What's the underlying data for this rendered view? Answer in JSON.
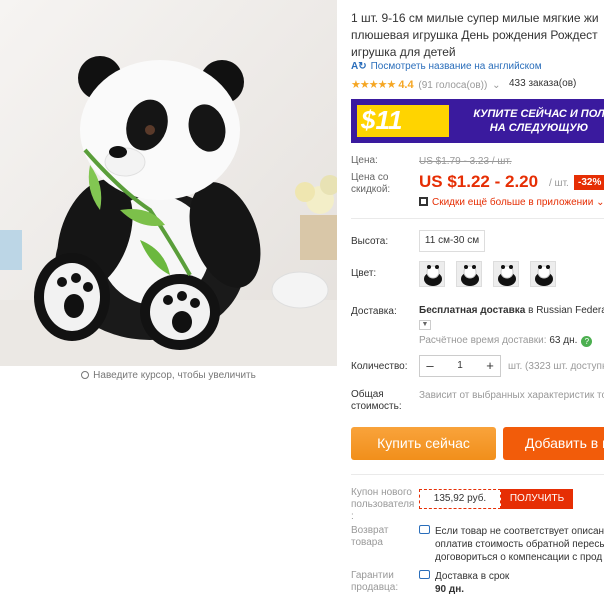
{
  "product": {
    "title_lines": [
      "1 шт. 9-16 см милые супер милые мягкие жи",
      "плюшевая игрушка День рождения Рождест",
      "игрушка для детей"
    ],
    "translate_link": "Посмотреть название на английском",
    "rating": 4.4,
    "rating_display": "4.4",
    "votes": "(91 голоса(ов))",
    "orders": "433 заказа(ов)",
    "zoom_hint": "Наведите курсор, чтобы увеличить"
  },
  "banner": {
    "amount": "$11",
    "line1": "КУПИТЕ СЕЙЧАС И ПОЛ",
    "line2": "НА СЛЕДУЮЩУЮ"
  },
  "price": {
    "label": "Цена:",
    "old": "US $1.79 - 3.23 / шт.",
    "discount_label_1": "Цена со",
    "discount_label_2": "скидкой:",
    "new": "US $1.22 - 2.20",
    "unit": "/ шт.",
    "discount_badge": "-32%",
    "app_promo": "Скидки ещё больше в приложении"
  },
  "options": {
    "height_label": "Высота:",
    "height_value": "11 см-30 см",
    "color_label": "Цвет:",
    "color_count": 4
  },
  "shipping": {
    "label": "Доставка:",
    "text_prefix": "Бесплатная доставка",
    "text_in": "в",
    "destination": "Russian Federa",
    "time_label": "Расчётное время доставки:",
    "time_value": "63 дн.",
    "help": "?"
  },
  "quantity": {
    "label": "Количество:",
    "value": "1",
    "minus": "–",
    "plus": "+",
    "note": "шт. (3323 шт. доступн"
  },
  "total": {
    "label_1": "Общая",
    "label_2": "стоимость:",
    "value": "Зависит от выбранных характеристик то"
  },
  "buttons": {
    "buy": "Купить сейчас",
    "cart": "Добавить в к"
  },
  "coupon": {
    "label_1": "Купон нового",
    "label_2": "пользователя",
    "label_3": ":",
    "value": "135,92 руб.",
    "get": "ПОЛУЧИТЬ"
  },
  "returns": {
    "label_1": "Возврат",
    "label_2": "товара",
    "line1": "Если товар не соответствует описан",
    "line2": "оплатив стоимость обратной пересы",
    "line3": "договориться о компенсации с прод"
  },
  "guarantee": {
    "label_1": "Гарантии",
    "label_2": "продавца:",
    "line1": "Доставка в срок",
    "line2": "90 дн."
  },
  "colors": {
    "accent_red": "#e62e04",
    "star": "#f5a623",
    "link": "#2a6ebb",
    "buy_button": "#f5a623",
    "cart_button": "#f25c0a",
    "banner_bg": "#3a1a9e",
    "banner_yellow": "#ffd400"
  }
}
